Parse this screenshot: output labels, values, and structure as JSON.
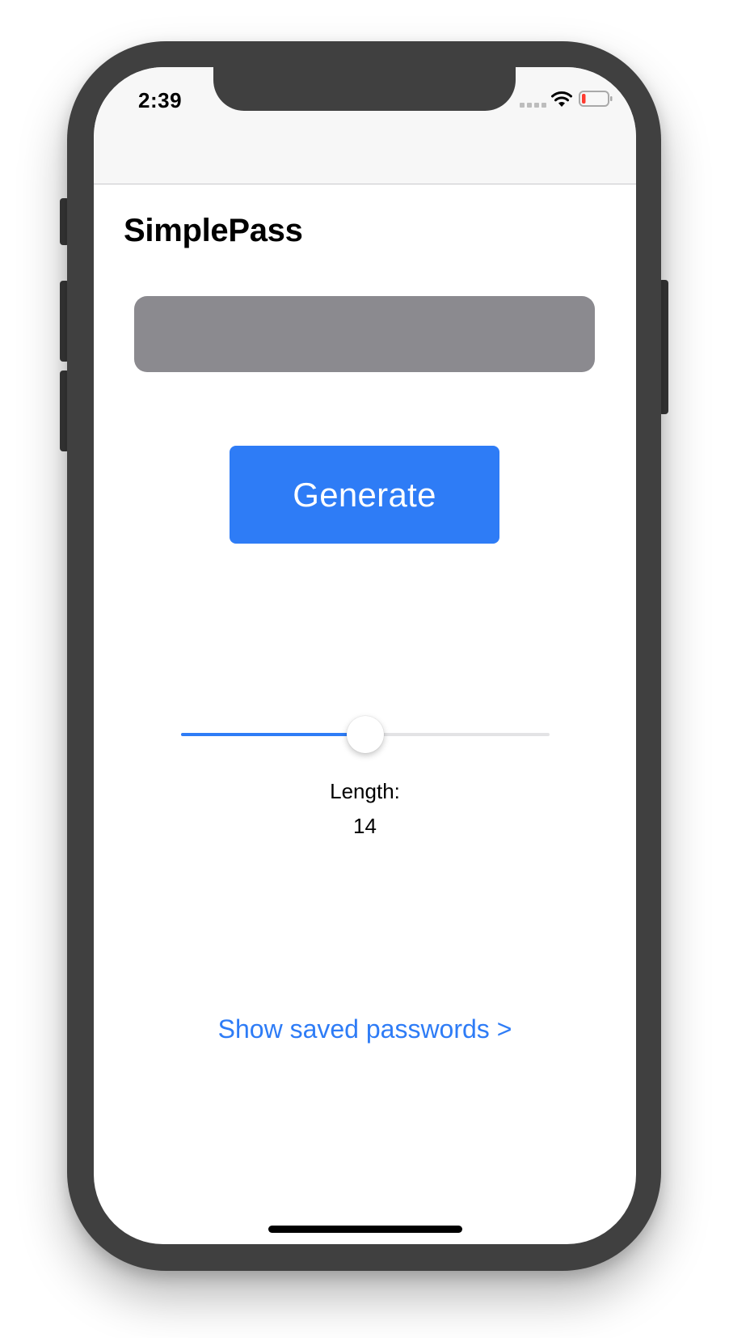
{
  "status_bar": {
    "time": "2:39",
    "signal_icon": "signal-dots-icon",
    "wifi_icon": "wifi-icon",
    "battery_icon": "battery-low-icon",
    "battery_level": 0.15
  },
  "app": {
    "title": "SimplePass"
  },
  "password_field": {
    "value": ""
  },
  "generate_button": {
    "label": "Generate"
  },
  "length_slider": {
    "value_fraction": 0.5
  },
  "length": {
    "label": "Length:",
    "value": "14"
  },
  "saved_link": {
    "label": "Show saved passwords >"
  },
  "colors": {
    "accent": "#2e7cf6",
    "field_background": "#8b8a8f",
    "frame": "#404040",
    "battery_low": "#ff3b30"
  }
}
